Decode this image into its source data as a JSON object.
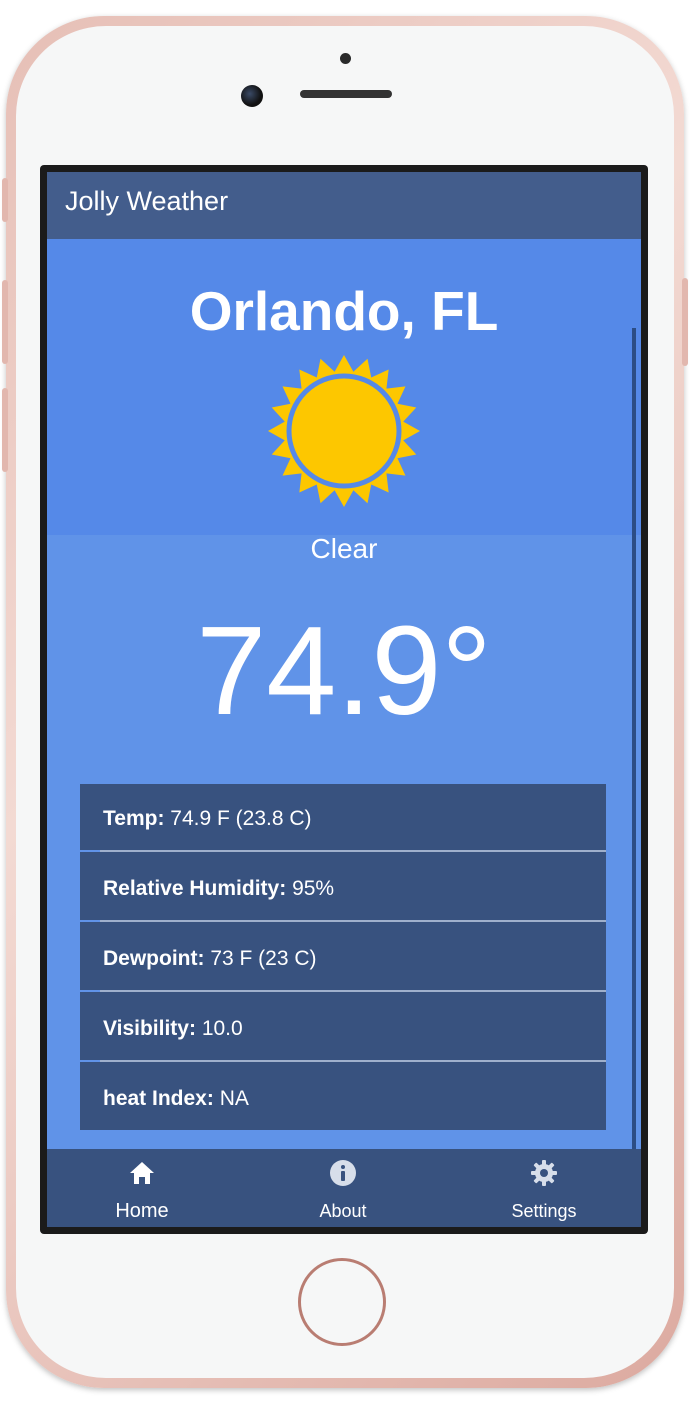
{
  "app": {
    "title": "Jolly Weather"
  },
  "weather": {
    "city": "Orlando, FL",
    "condition": "Clear",
    "icon": "sun-icon",
    "temperature": "74.9°"
  },
  "details": [
    {
      "label": "Temp:",
      "value": "74.9 F (23.8 C)"
    },
    {
      "label": "Relative Humidity:",
      "value": "95%"
    },
    {
      "label": "Dewpoint:",
      "value": "73 F (23 C)"
    },
    {
      "label": "Visibility:",
      "value": "10.0"
    },
    {
      "label": "heat Index:",
      "value": "NA"
    }
  ],
  "nav": [
    {
      "label": "Home",
      "icon": "home-icon",
      "selected": true
    },
    {
      "label": "About",
      "icon": "info-icon",
      "selected": false
    },
    {
      "label": "Settings",
      "icon": "gear-icon",
      "selected": false
    }
  ],
  "colors": {
    "app_bar": "#435d8c",
    "header_bg": "#5589e8",
    "content_bg": "#6093e8",
    "panel_bg": "#38527f",
    "sun_yellow": "#fdc700",
    "phone_frame": "#e6bfb6"
  }
}
